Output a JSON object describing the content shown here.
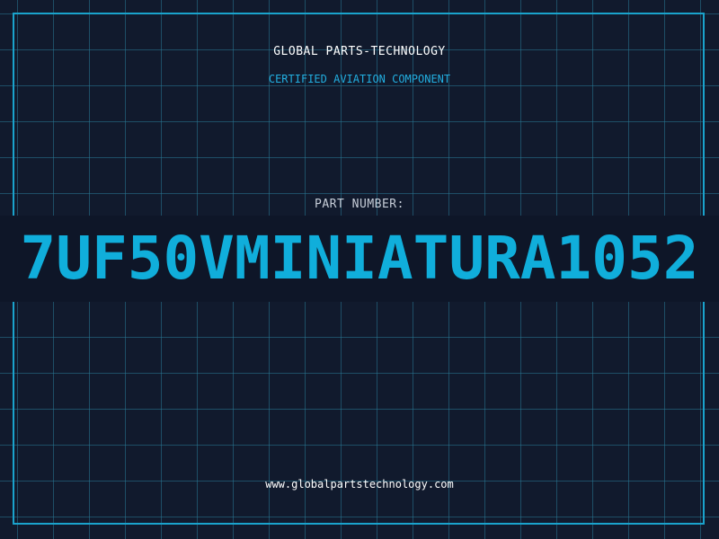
{
  "header": {
    "company": "GLOBAL PARTS-TECHNOLOGY",
    "subtitle": "CERTIFIED AVIATION COMPONENT"
  },
  "part": {
    "label": "PART NUMBER:",
    "number": "7UF50VMINIATURA1052"
  },
  "footer": {
    "website": "www.globalpartstechnology.com"
  },
  "colors": {
    "background": "#111a2d",
    "grid": "#28789a",
    "accent": "#10aedb",
    "frame": "#1aa3cc",
    "text": "#ffffff"
  }
}
